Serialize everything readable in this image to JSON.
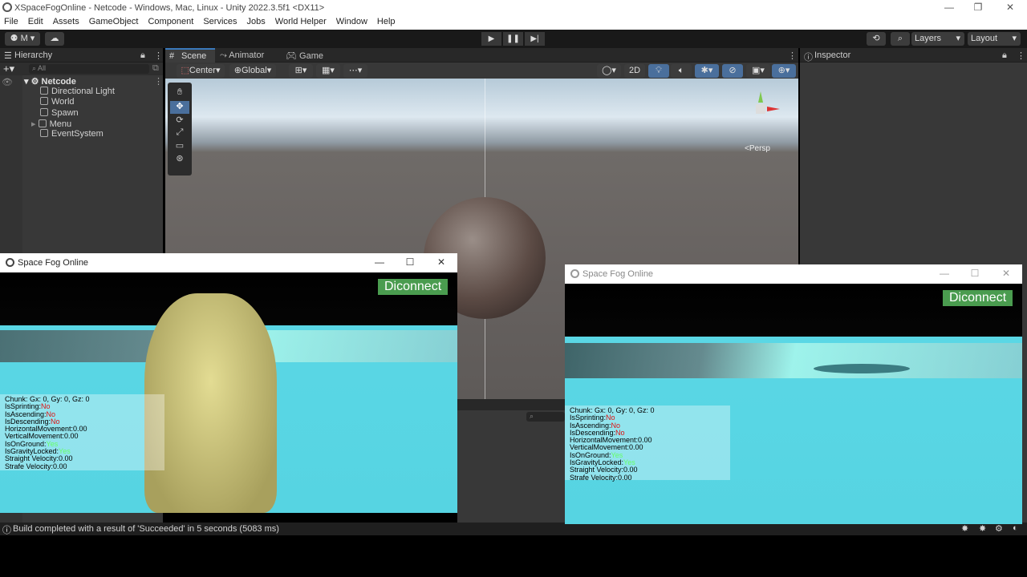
{
  "window": {
    "title": "XSpaceFogOnline - Netcode - Windows, Mac, Linux - Unity 2022.3.5f1 <DX11>"
  },
  "menu": [
    "File",
    "Edit",
    "Assets",
    "GameObject",
    "Component",
    "Services",
    "Jobs",
    "World Helper",
    "Window",
    "Help"
  ],
  "toolbar": {
    "account": "M",
    "layers": "Layers",
    "layout": "Layout"
  },
  "hierarchy": {
    "tab": "Hierarchy",
    "search_placeholder": "All",
    "root": "Netcode",
    "items": [
      "Directional Light",
      "World",
      "Spawn",
      "Menu",
      "EventSystem"
    ]
  },
  "scene": {
    "tabs": [
      "Scene",
      "Animator",
      "Game"
    ],
    "pivot": "Center",
    "space": "Global",
    "mode_2d": "2D",
    "persp": "<Persp"
  },
  "inspector": {
    "tab": "Inspector"
  },
  "status": {
    "message": "Build completed with a result of 'Succeeded' in 5 seconds (5083 ms)"
  },
  "game_window_left": {
    "title": "Space Fog Online",
    "button": "Diconnect",
    "debug": {
      "chunk": "Chunk: Gx: 0, Gy: 0, Gz: 0",
      "sprinting_label": "IsSprinting:",
      "sprinting": "No",
      "ascending_label": "IsAscending:",
      "ascending": "No",
      "descending_label": "IsDescending:",
      "descending": "No",
      "hmove": "HorizontalMovement:0.00",
      "vmove": "VerticalMovement:0.00",
      "ground_label": "IsOnGround:",
      "ground": "Yes",
      "gravity_label": "IsGravityLocked:",
      "gravity": "Yes",
      "straight": "Straight Velocity:0.00",
      "strafe": "Strafe Velocity:0.00"
    }
  },
  "game_window_right": {
    "title": "Space Fog Online",
    "button": "Diconnect",
    "debug": {
      "chunk": "Chunk: Gx: 0, Gy: 0, Gz: 0",
      "sprinting_label": "IsSprinting:",
      "sprinting": "No",
      "ascending_label": "IsAscending:",
      "ascending": "No",
      "descending_label": "IsDescending:",
      "descending": "No",
      "hmove": "HorizontalMovement:0.00",
      "vmove": "VerticalMovement:0.00",
      "ground_label": "IsOnGround:",
      "ground": "Yes",
      "gravity_label": "IsGravityLocked:",
      "gravity": "Yes",
      "straight": "Straight Velocity:0.00",
      "strafe": "Strafe Velocity:0.00"
    }
  }
}
